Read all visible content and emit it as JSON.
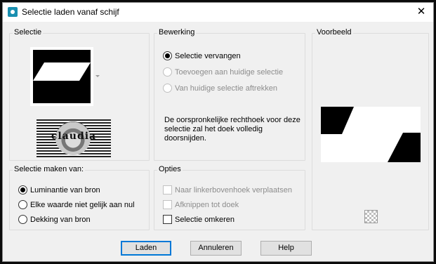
{
  "window": {
    "title": "Selectie laden vanaf schijf",
    "close_glyph": "✕"
  },
  "selectie": {
    "legend": "Selectie",
    "logo_text": "claudia"
  },
  "bewerking": {
    "legend": "Bewerking",
    "options": [
      {
        "label": "Selectie vervangen",
        "selected": true,
        "enabled": true
      },
      {
        "label": "Toevoegen aan huidige selectie",
        "selected": false,
        "enabled": false
      },
      {
        "label": "Van huidige selectie aftrekken",
        "selected": false,
        "enabled": false
      }
    ],
    "info": "De oorspronkelijke rechthoek voor deze selectie zal het doek volledig doorsnijden."
  },
  "voorbeeld": {
    "legend": "Voorbeeld",
    "reset_icon": "checkerboard-reset-icon"
  },
  "selectie_maken_van": {
    "legend": "Selectie maken van:",
    "options": [
      {
        "label": "Luminantie van bron",
        "selected": true
      },
      {
        "label": "Elke waarde niet gelijk aan nul",
        "selected": false
      },
      {
        "label": "Dekking van bron",
        "selected": false
      }
    ]
  },
  "opties": {
    "legend": "Opties",
    "checks": [
      {
        "label": "Naar linkerbovenhoek verplaatsen",
        "checked": false,
        "enabled": false
      },
      {
        "label": "Afknippen tot doek",
        "checked": false,
        "enabled": false
      },
      {
        "label": "Selectie omkeren",
        "checked": false,
        "enabled": true
      }
    ]
  },
  "buttons": {
    "load": "Laden",
    "cancel": "Annuleren",
    "help": "Help"
  },
  "colors": {
    "accent": "#0078d7",
    "disabled_text": "#8d8d8d"
  }
}
